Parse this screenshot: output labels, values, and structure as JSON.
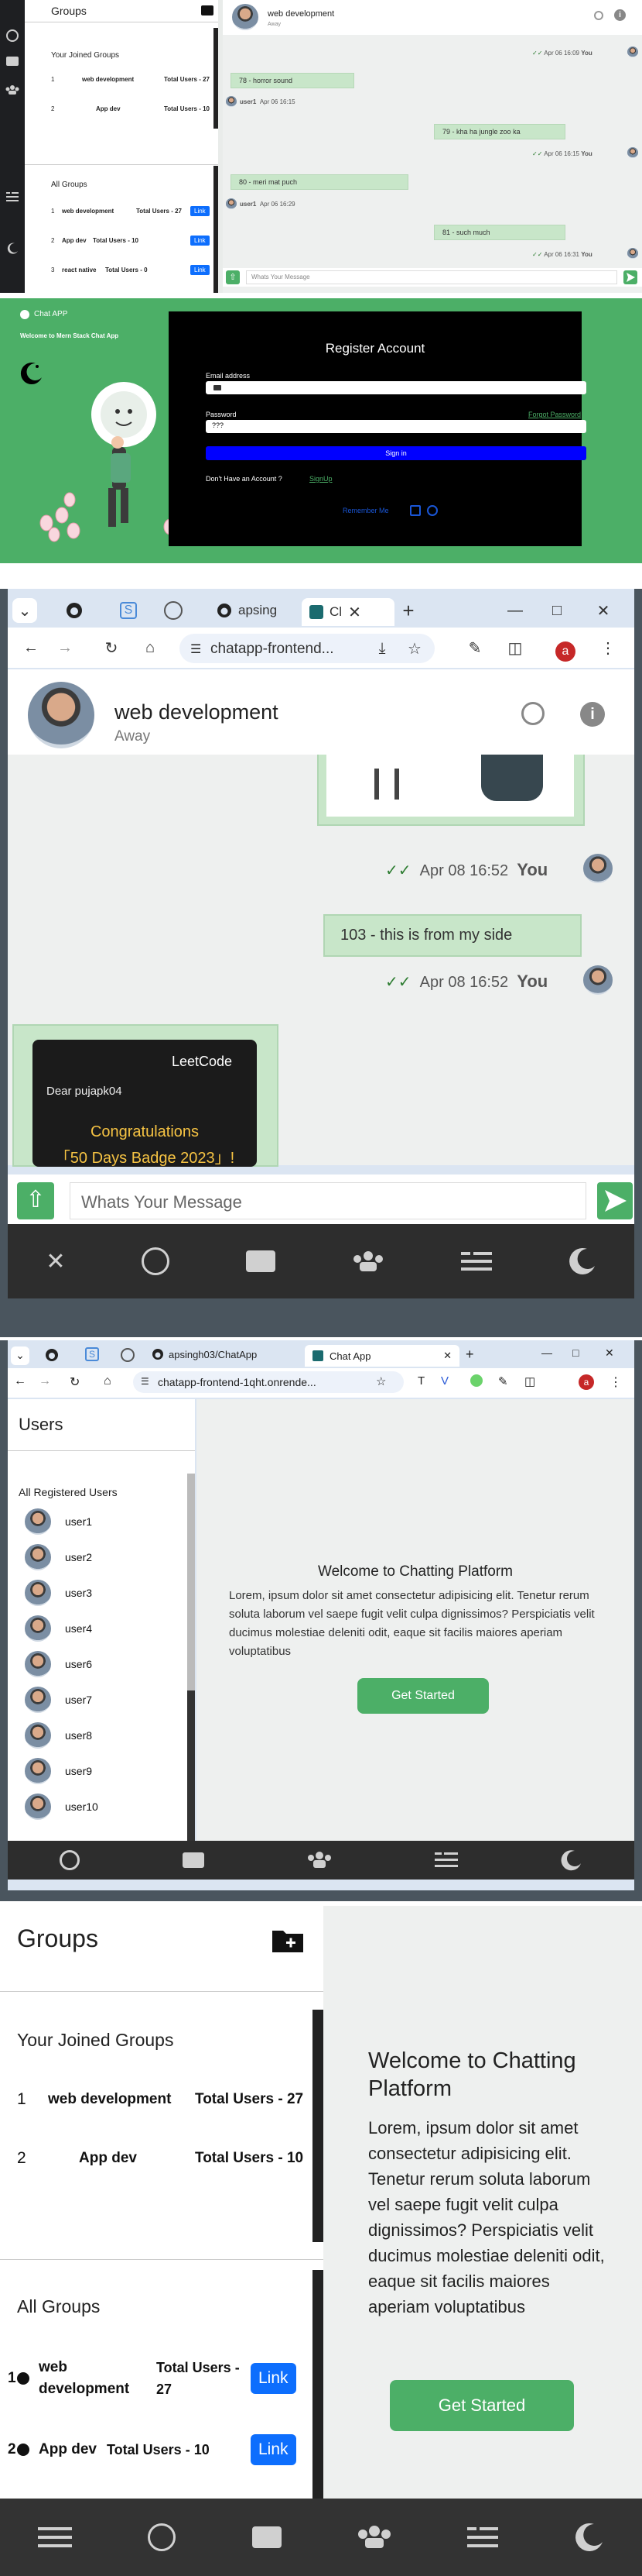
{
  "s1": {
    "groups_title": "Groups",
    "joined_title": "Your Joined Groups",
    "joined": [
      {
        "num": "1",
        "name": "web development",
        "total": "Total Users - 27"
      },
      {
        "num": "2",
        "name": "App dev",
        "total": "Total Users - 10"
      }
    ],
    "all_title": "All Groups",
    "all": [
      {
        "num": "1",
        "name": "web development",
        "total": "Total Users - 27",
        "btn": "Link"
      },
      {
        "num": "2",
        "name": "App dev",
        "total": "Total Users - 10",
        "btn": "Link"
      },
      {
        "num": "3",
        "name": "react native",
        "total": "Total Users - 0",
        "btn": "Link"
      }
    ],
    "chat_name": "web development",
    "chat_status": "Away",
    "messages": [
      {
        "text": "78 - horror sound"
      },
      {
        "text": "79 - kha ha jungle zoo ka"
      },
      {
        "text": "80 - meri mat puch"
      },
      {
        "text": "81 - such much"
      }
    ],
    "metas": [
      {
        "time": "Apr 06 16:09",
        "who": "You"
      },
      {
        "user": "user1",
        "time": "Apr 06 16:15"
      },
      {
        "time": "Apr 06 16:15",
        "who": "You"
      },
      {
        "user": "user1",
        "time": "Apr 06 16:29"
      },
      {
        "time": "Apr 06 16:31",
        "who": "You"
      }
    ],
    "input_placeholder": "Whats Your Message"
  },
  "s2": {
    "app_title": "Chat APP",
    "welcome": "Welcome to Mern Stack Chat App",
    "heading": "Register Account",
    "email_label": "Email address",
    "email_value": "",
    "password_label": "Password",
    "forgot": "Forgot Password",
    "password_value": "???",
    "signin": "Sign in",
    "no_account": "Don't Have an Account ?",
    "signup": "SignUp",
    "remember": "Remember Me"
  },
  "s3": {
    "tabs": [
      {
        "label": "apsing"
      },
      {
        "label": "Cl"
      }
    ],
    "url": "chatapp-frontend...",
    "profile_letter": "a",
    "chat_name": "web development",
    "chat_status": "Away",
    "meta1": {
      "time": "Apr 08 16:52",
      "who": "You"
    },
    "message": "103 - this is from my side",
    "meta2": {
      "time": "Apr 08 16:52",
      "who": "You"
    },
    "card_brand": "LeetCode",
    "card_greeting": "Dear pujapk04",
    "card_title": "Congratulations",
    "card_badge": "「50 Days Badge 2023」!",
    "input_placeholder": "Whats Your Message"
  },
  "s4": {
    "tabs": [
      {
        "label": "apsingh03/ChatApp"
      },
      {
        "label": "Chat App"
      }
    ],
    "url": "chatapp-frontend-1qht.onrende...",
    "profile_letter": "a",
    "users_title": "Users",
    "registered_title": "All Registered Users",
    "users": [
      "user1",
      "user2",
      "user3",
      "user4",
      "user6",
      "user7",
      "user8",
      "user9",
      "user10"
    ],
    "welcome_title": "Welcome to Chatting Platform",
    "welcome_text": "Lorem, ipsum dolor sit amet consectetur adipisicing elit. Tenetur rerum soluta laborum vel saepe fugit velit culpa dignissimos? Perspiciatis velit ducimus molestiae deleniti odit, eaque sit facilis maiores aperiam voluptatibus",
    "button": "Get Started"
  },
  "s5": {
    "groups_title": "Groups",
    "joined_title": "Your Joined Groups",
    "joined": [
      {
        "num": "1",
        "name": "web development",
        "total": "Total Users - 27"
      },
      {
        "num": "2",
        "name": "App dev",
        "total": "Total Users - 10"
      }
    ],
    "all_title": "All Groups",
    "all": [
      {
        "num": "1",
        "name": "web development",
        "total": "Total Users - 27",
        "btn": "Link"
      },
      {
        "num": "2",
        "name": "App dev",
        "total": "Total Users - 10",
        "btn": "Link"
      }
    ],
    "welcome_title": "Welcome to Chatting Platform",
    "welcome_text": "Lorem, ipsum dolor sit amet consectetur adipisicing elit. Tenetur rerum soluta laborum vel saepe fugit velit culpa dignissimos? Perspiciatis velit ducimus molestiae deleniti odit, eaque sit facilis maiores aperiam voluptatibus",
    "button": "Get Started"
  },
  "colors": {
    "accent_green": "#4caf67",
    "link_blue": "#0d6efd",
    "bubble": "#c8e6c9",
    "dark_bar": "#2d2d2d"
  }
}
